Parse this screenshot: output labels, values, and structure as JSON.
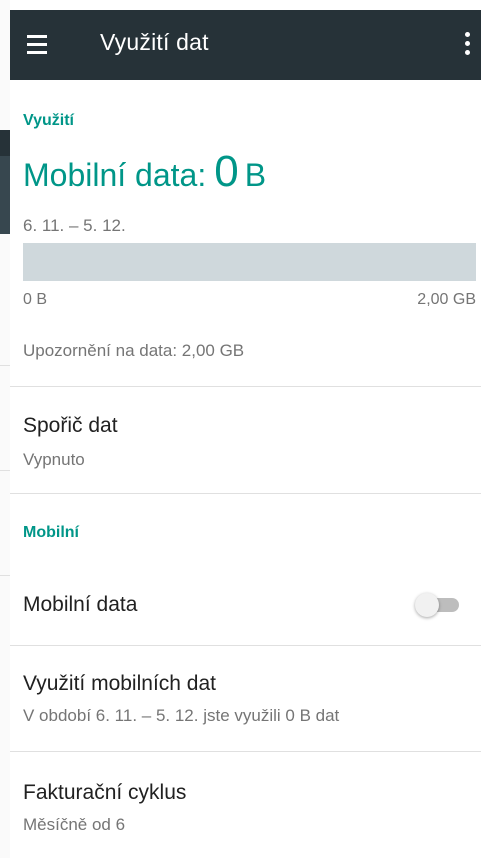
{
  "toolbar": {
    "title": "Využití dat",
    "menu_icon": "hamburger-menu-icon",
    "overflow_icon": "more-vert-icon",
    "background": "#263238"
  },
  "accent_color": "#009688",
  "usage_section": {
    "header": "Využití",
    "mobile_data_label": "Mobilní data:",
    "mobile_data_value": "0",
    "mobile_data_unit": "B",
    "period": "6. 11. – 5. 12.",
    "bar": {
      "used_fraction": 0,
      "min_label": "0 B",
      "max_label": "2,00 GB"
    },
    "warning": "Upozornění na data: 2,00 GB"
  },
  "data_saver": {
    "title": "Spořič dat",
    "status": "Vypnuto"
  },
  "mobile_section": {
    "header": "Mobilní",
    "mobile_data_toggle": {
      "label": "Mobilní data",
      "enabled": false
    },
    "mobile_data_usage": {
      "title": "Využití mobilních dat",
      "summary": "V období 6. 11. – 5. 12. jste využili 0 B dat"
    },
    "billing_cycle": {
      "title": "Fakturační cyklus",
      "summary": "Měsíčně od 6"
    }
  }
}
